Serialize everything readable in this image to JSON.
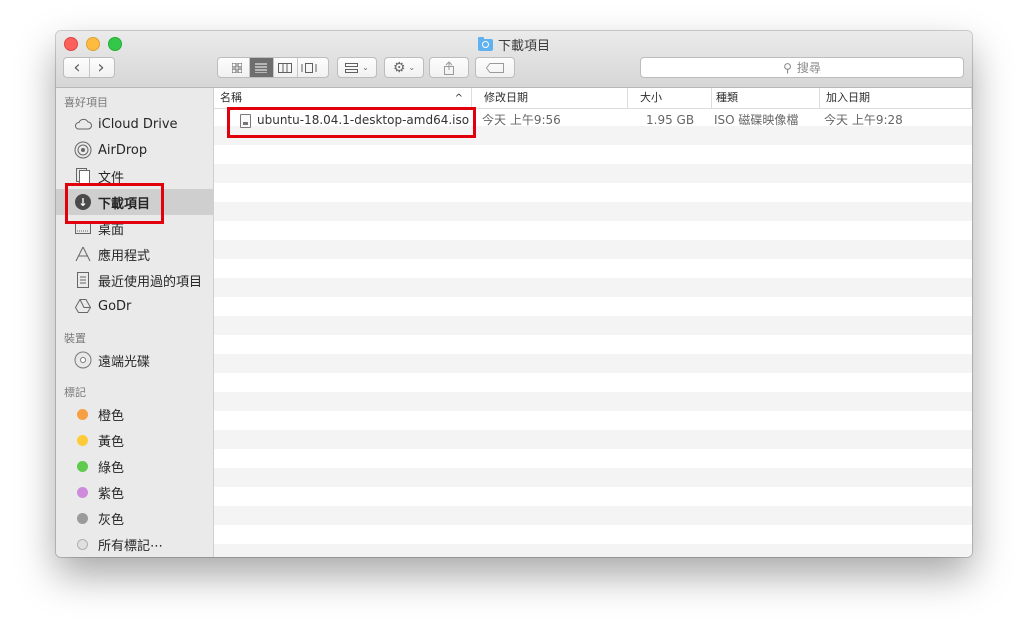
{
  "window": {
    "title": "下載項目"
  },
  "toolbar": {
    "back_label": "‹",
    "forward_label": "›",
    "search_placeholder": "搜尋"
  },
  "sidebar": {
    "sections": {
      "favorites": "喜好項目",
      "devices": "裝置",
      "tags": "標記"
    },
    "favorites": [
      {
        "label": "iCloud Drive",
        "icon": "cloud-icon"
      },
      {
        "label": "AirDrop",
        "icon": "airdrop-icon"
      },
      {
        "label": "文件",
        "icon": "document-icon"
      },
      {
        "label": "下載項目",
        "icon": "download-icon",
        "selected": true
      },
      {
        "label": "桌面",
        "icon": "desktop-icon"
      },
      {
        "label": "應用程式",
        "icon": "applications-icon"
      },
      {
        "label": "最近使用過的項目",
        "icon": "recents-icon"
      },
      {
        "label": "GoDr",
        "icon": "google-drive-icon"
      }
    ],
    "devices": [
      {
        "label": "遠端光碟",
        "icon": "disc-icon"
      }
    ],
    "tags": [
      {
        "label": "橙色",
        "color": "#f7a043"
      },
      {
        "label": "黃色",
        "color": "#fdcb3a"
      },
      {
        "label": "綠色",
        "color": "#5ecb4c"
      },
      {
        "label": "紫色",
        "color": "#cf8bdb"
      },
      {
        "label": "灰色",
        "color": "#9b9b9b"
      },
      {
        "label": "所有標記⋯",
        "color": "#e0e0e0"
      }
    ]
  },
  "columns": {
    "name": "名稱",
    "modified": "修改日期",
    "size": "大小",
    "kind": "種類",
    "added": "加入日期",
    "sort_arrow": "^"
  },
  "files": [
    {
      "name": "ubuntu-18.04.1-desktop-amd64.iso",
      "modified": "今天 上午9:56",
      "size": "1.95 GB",
      "kind": "ISO 磁碟映像檔",
      "added": "今天 上午9:28"
    }
  ],
  "highlight_color": "#e2000d"
}
